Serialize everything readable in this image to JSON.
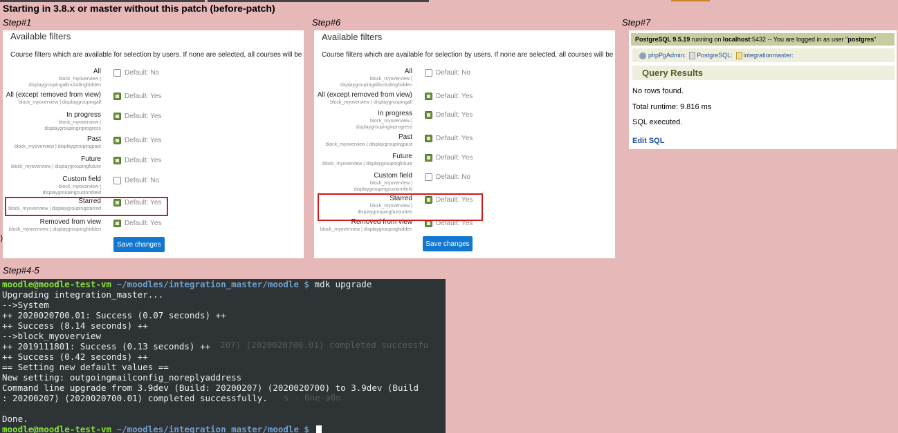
{
  "heading": "Starting in 3.8.x or master without this patch (before-patch)",
  "steps": {
    "s1": "Step#1",
    "s6": "Step#6",
    "s7": "Step#7",
    "s45": "Step#4-5"
  },
  "panel1": {
    "title": "Available filters",
    "desc": "Course filters which are available for selection by users. If none are selected, all courses will be displayed.",
    "save": "Save changes",
    "rows": [
      {
        "name": "All",
        "sub": "block_myoverview | displaygroupingallincludinghidden",
        "checked": false,
        "default": "Default: No"
      },
      {
        "name": "All (except removed from view)",
        "sub": "block_myoverview | displaygroupingall",
        "checked": true,
        "default": "Default: Yes"
      },
      {
        "name": "In progress",
        "sub": "block_myoverview | displaygroupinginprogress",
        "checked": true,
        "default": "Default: Yes"
      },
      {
        "name": "Past",
        "sub": "block_myoverview | displaygroupingpast",
        "checked": true,
        "default": "Default: Yes"
      },
      {
        "name": "Future",
        "sub": "block_myoverview | displaygroupingfuture",
        "checked": true,
        "default": "Default: Yes"
      },
      {
        "name": "Custom field",
        "sub": "block_myoverview | displaygroupingcustomfield",
        "checked": false,
        "default": "Default: No"
      },
      {
        "name": "Starred",
        "sub": "block_myoverview | displaygroupingstarred",
        "checked": true,
        "default": "Default: Yes"
      },
      {
        "name": "Removed from view",
        "sub": "block_myoverview | displaygroupinghidden",
        "checked": true,
        "default": "Default: Yes"
      }
    ]
  },
  "panel2": {
    "title": "Available filters",
    "desc": "Course filters which are available for selection by users. If none are selected, all courses will be displayed.",
    "save": "Save changes",
    "rows": [
      {
        "name": "All",
        "sub": "block_myoverview | displaygroupingallincludinghidden",
        "checked": false,
        "default": "Default: No"
      },
      {
        "name": "All (except removed from view)",
        "sub": "block_myoverview | displaygroupingall",
        "checked": true,
        "default": "Default: Yes"
      },
      {
        "name": "In progress",
        "sub": "block_myoverview | displaygroupinginprogress",
        "checked": true,
        "default": "Default: Yes"
      },
      {
        "name": "Past",
        "sub": "block_myoverview | displaygroupingpast",
        "checked": true,
        "default": "Default: Yes"
      },
      {
        "name": "Future",
        "sub": "block_myoverview | displaygroupingfuture",
        "checked": true,
        "default": "Default: Yes"
      },
      {
        "name": "Custom field",
        "sub": "block_myoverview | displaygroupingcustomfield",
        "checked": false,
        "default": "Default: No"
      },
      {
        "name": "Starred",
        "sub": "block_myoverview | displaygroupingfavourites",
        "checked": true,
        "default": "Default: Yes"
      },
      {
        "name": "Removed from view",
        "sub": "block_myoverview | displaygroupinghidden",
        "checked": true,
        "default": "Default: Yes"
      }
    ]
  },
  "pg": {
    "server": "PostgreSQL 9.5.19",
    "running_on": " running on ",
    "host": "localhost",
    "port_msg": ":5432 -- You are logged in as user \"",
    "user": "postgres",
    "user_end": "\"",
    "nav_phppgadmin": "phpPgAdmin",
    "nav_postgresql": "PostgreSQL",
    "nav_db": "integrationmaster",
    "results_title": "Query Results",
    "no_rows": "No rows found.",
    "runtime": "Total runtime: 9.816 ms",
    "executed": "SQL executed.",
    "edit": "Edit SQL"
  },
  "terminal": {
    "prompt_user": "moodle@moodle-test-vm",
    "prompt_path": " ~/moodles/integration_master/moodle $",
    "command": " mdk upgrade",
    "lines": [
      "Upgrading integration_master...",
      "-->System",
      "++ 2020020700.01: Success (0.07 seconds) ++",
      "++ Success (8.14 seconds) ++",
      "-->block_myoverview",
      "++ 2019111801: Success (0.13 seconds) ++",
      "++ Success (0.42 seconds) ++",
      "== Setting new default values ==",
      "New setting: outgoingmailconfig_noreplyaddress",
      "Command line upgrade from 3.9dev (Build: 20200207) (2020020700) to 3.9dev (Build",
      ": 20200207) (2020020700.01) completed successfully.",
      "",
      "Done."
    ],
    "ghost1": "207) (2020020700.01) completed successfu",
    "ghost2": "s - 0ne-a0n"
  }
}
